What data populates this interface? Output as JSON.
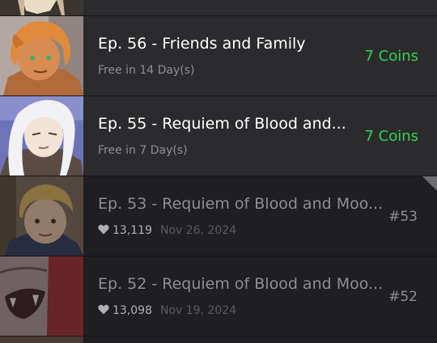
{
  "episodes": [
    {
      "title": "Ep. 56 - Friends and Family",
      "subtitle": "Free in 14 Day(s)",
      "price": "7 Coins",
      "thumbnail_icon": "character-thumbnail-orange-hair"
    },
    {
      "title": "Ep. 55 - Requiem of Blood and...",
      "subtitle": "Free in 7 Day(s)",
      "price": "7 Coins",
      "thumbnail_icon": "character-thumbnail-white-hair"
    },
    {
      "title": "Ep. 53 - Requiem of Blood and Moo...",
      "likes": "13,119",
      "date": "Nov 26, 2024",
      "number": "#53",
      "thumbnail_icon": "character-thumbnail-blond-boy"
    },
    {
      "title": "Ep. 52 - Requiem of Blood and Moo...",
      "likes": "13,098",
      "date": "Nov 19, 2024",
      "number": "#52",
      "thumbnail_icon": "character-thumbnail-fanged-mouth"
    }
  ],
  "colors": {
    "price": "#30d158",
    "locked_row_bg": "#2b2b2e",
    "read_row_bg": "#1f1f21"
  }
}
